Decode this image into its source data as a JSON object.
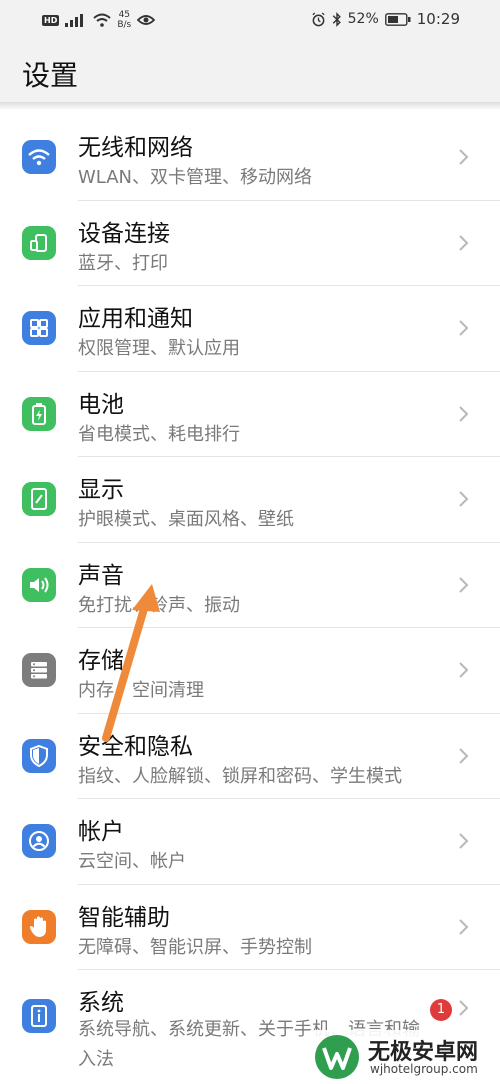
{
  "status_bar": {
    "hd_label": "HD",
    "net_speed_value": "45",
    "net_speed_unit": "B/s",
    "battery_percent": "52%",
    "time": "10:29"
  },
  "header": {
    "title": "设置"
  },
  "colors": {
    "accent_blue": "#3f7fe0",
    "accent_green": "#3fbf5f",
    "gray": "#7d7d7d",
    "orange": "#ef7d2a",
    "arrow": "#ef8a3a"
  },
  "items": [
    {
      "title": "无线和网络",
      "subtitle": "WLAN、双卡管理、移动网络",
      "icon": "wifi-icon",
      "color": "#3f7fe0"
    },
    {
      "title": "设备连接",
      "subtitle": "蓝牙、打印",
      "icon": "device-connection-icon",
      "color": "#3fbf5f"
    },
    {
      "title": "应用和通知",
      "subtitle": "权限管理、默认应用",
      "icon": "apps-grid-icon",
      "color": "#3f7fe0"
    },
    {
      "title": "电池",
      "subtitle": "省电模式、耗电排行",
      "icon": "battery-icon",
      "color": "#3fbf5f"
    },
    {
      "title": "显示",
      "subtitle": "护眼模式、桌面风格、壁纸",
      "icon": "display-icon",
      "color": "#3fbf5f"
    },
    {
      "title": "声音",
      "subtitle": "免打扰、铃声、振动",
      "icon": "sound-icon",
      "color": "#3fbf5f"
    },
    {
      "title": "存储",
      "subtitle": "内存、空间清理",
      "icon": "storage-icon",
      "color": "#7d7d7d"
    },
    {
      "title": "安全和隐私",
      "subtitle": "指纹、人脸解锁、锁屏和密码、学生模式",
      "icon": "shield-icon",
      "color": "#3f7fe0"
    },
    {
      "title": "帐户",
      "subtitle": "云空间、帐户",
      "icon": "account-icon",
      "color": "#3f7fe0"
    },
    {
      "title": "智能辅助",
      "subtitle": "无障碍、智能识屏、手势控制",
      "icon": "hand-icon",
      "color": "#ef7d2a"
    },
    {
      "title": "系统",
      "subtitle": "系统导航、系统更新、关于手机、语言和输入法",
      "icon": "system-info-icon",
      "color": "#3f7fe0",
      "badge": "1"
    }
  ],
  "watermark": {
    "name": "无极安卓网",
    "url": "wjhotelgroup.com"
  }
}
